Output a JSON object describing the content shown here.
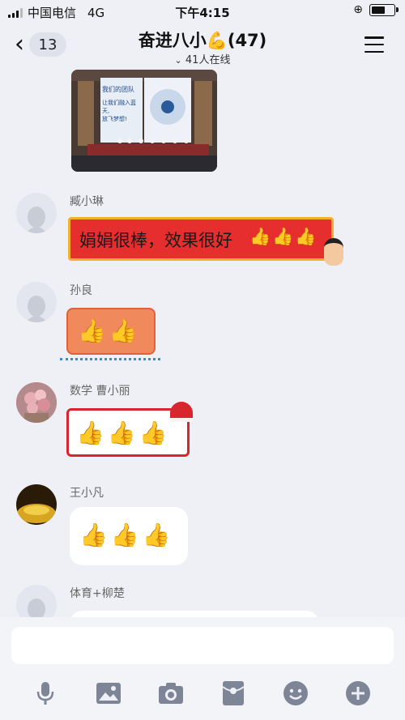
{
  "status": {
    "carrier": "中国电信",
    "network": "4G",
    "time": "下午4:15"
  },
  "header": {
    "back_count": "13",
    "title": "奋进八小💪(47)",
    "online": "41人在线"
  },
  "messages": [
    {
      "name": "",
      "type": "image",
      "image_text": [
        "我们的团队",
        "让我们融入蓝天,",
        "放飞梦想!"
      ]
    },
    {
      "name": "臧小琳",
      "type": "banner",
      "text": "娟娟很棒，效果很好",
      "emoji": "👍👍👍"
    },
    {
      "name": "孙良",
      "type": "sticker",
      "emoji": "👍👍"
    },
    {
      "name": "数学 曹小丽",
      "type": "sticker",
      "emoji": "👍👍👍"
    },
    {
      "name": "王小凡",
      "type": "text",
      "emoji": "👍👍👍"
    },
    {
      "name": "体育+柳楚",
      "type": "text",
      "emoji": ""
    }
  ],
  "toolbar": {
    "icons": [
      "microphone-icon",
      "image-icon",
      "camera-icon",
      "red-packet-icon",
      "emoji-icon",
      "plus-icon"
    ]
  }
}
